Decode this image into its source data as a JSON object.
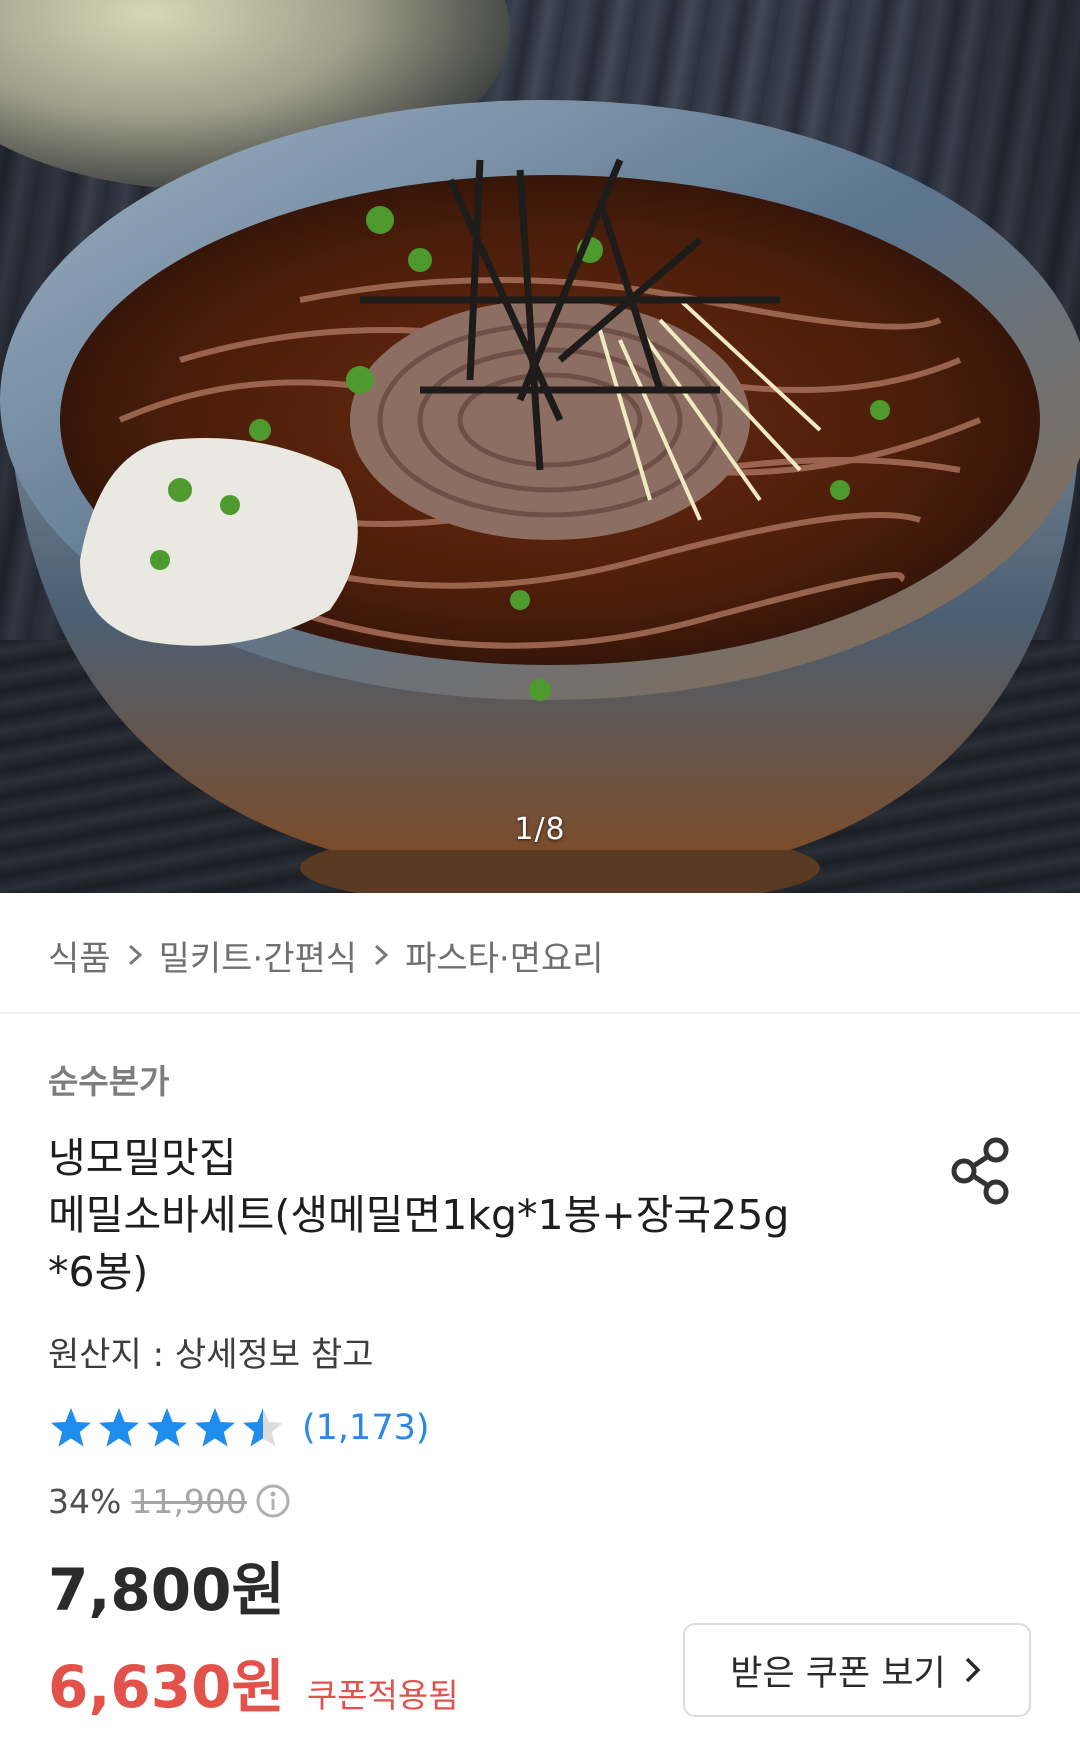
{
  "gallery": {
    "current": "1/8"
  },
  "breadcrumb": {
    "items": [
      "식품",
      "밀키트·간편식",
      "파스타·면요리"
    ]
  },
  "product": {
    "brand": "순수본가",
    "title_lines": [
      "냉모밀맛집",
      "메밀소바세트(생메밀면1kg*1봉+장국25g",
      "*6봉)"
    ],
    "origin": "원산지 : 상세정보 참고",
    "rating": 4.5,
    "review_count": "(1,173)",
    "discount_rate": "34%",
    "original_price": "11,900",
    "price": "7,800원",
    "coupon_price": "6,630원",
    "coupon_note": "쿠폰적용됨"
  },
  "coupon_button": {
    "label": "받은 쿠폰 보기"
  },
  "colors": {
    "star": "#1f8cf0",
    "review_link": "#2c88e6",
    "coupon_red": "#e3514b"
  },
  "icons": [
    "share-icon",
    "info-icon",
    "chevron-right-icon",
    "star-icon"
  ]
}
